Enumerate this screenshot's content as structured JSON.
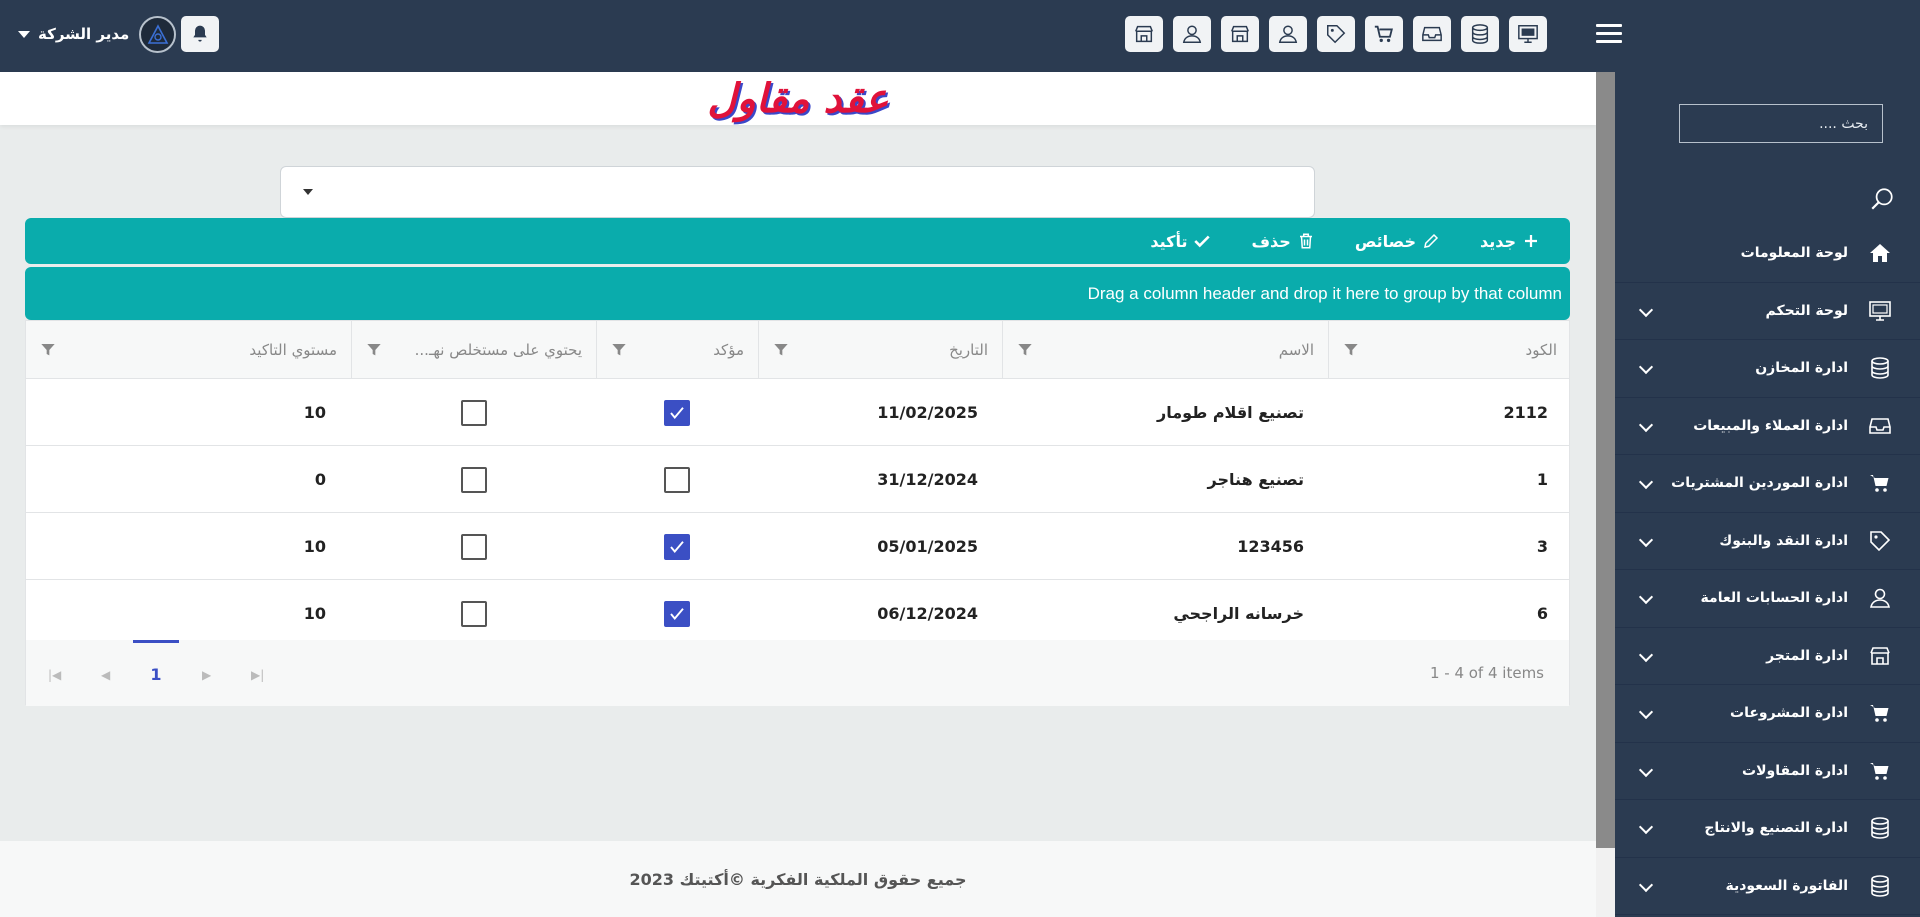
{
  "header": {
    "user_label": "مدير الشركة",
    "icons": [
      "monitor-icon",
      "database-icon",
      "inbox-icon",
      "cart-icon",
      "tag-icon",
      "user-icon",
      "store-icon",
      "user-icon",
      "store-icon"
    ]
  },
  "sidebar": {
    "search_placeholder": "بحث ....",
    "items": [
      {
        "label": "لوحة المعلومات",
        "icon": "home-icon"
      },
      {
        "label": "لوحة التحكم",
        "icon": "monitor-icon"
      },
      {
        "label": "ادارة المخازن",
        "icon": "database-icon"
      },
      {
        "label": "ادارة العملاء والمبيعات",
        "icon": "inbox-icon"
      },
      {
        "label": "ادارة الموردين المشتريات",
        "icon": "cart-icon"
      },
      {
        "label": "ادارة النقد والبنوك",
        "icon": "tag-icon"
      },
      {
        "label": "ادارة الحسابات العامة",
        "icon": "user-icon"
      },
      {
        "label": "ادارة المتجر",
        "icon": "store-icon"
      },
      {
        "label": "ادارة المشروعات",
        "icon": "cart-icon"
      },
      {
        "label": "ادارة المقاولات",
        "icon": "cart-icon"
      },
      {
        "label": "ادارة التصنيع والانتاج",
        "icon": "database-icon"
      },
      {
        "label": "الفاتورة السعودية",
        "icon": "database-icon"
      }
    ]
  },
  "main": {
    "page_title": "عقد مقاول",
    "toolbar": {
      "new_label": "جديد",
      "properties_label": "خصائص",
      "delete_label": "حذف",
      "confirm_label": "تأكيد"
    },
    "group_hint": "Drag a column header and drop it here to group by that column",
    "columns": [
      "الكود",
      "الاسم",
      "التاريخ",
      "مؤكد",
      "يحتوي على مستخلص نهـ...",
      "مستوي التاكيد"
    ],
    "rows": [
      {
        "code": "2112",
        "name": "تصنيع اقلام طومار",
        "date": "11/02/2025",
        "confirmed": true,
        "final": false,
        "level": "10"
      },
      {
        "code": "1",
        "name": "تصنيع هناجر",
        "date": "31/12/2024",
        "confirmed": false,
        "final": false,
        "level": "0"
      },
      {
        "code": "3",
        "name": "123456",
        "date": "05/01/2025",
        "confirmed": true,
        "final": false,
        "level": "10"
      },
      {
        "code": "6",
        "name": "خرسانه الراجحي",
        "date": "06/12/2024",
        "confirmed": true,
        "final": false,
        "level": "10"
      }
    ],
    "pager": {
      "current_page": "1",
      "items_info": "1 - 4 of 4 items"
    }
  },
  "footer": {
    "text": "جميع حقوق الملكية الفكرية ©أكتيتك 2023"
  },
  "colors": {
    "topbar": "#2b3b51",
    "teal": "#0aacac",
    "checkbox": "#3b4fc4",
    "title": "#e0123a"
  }
}
